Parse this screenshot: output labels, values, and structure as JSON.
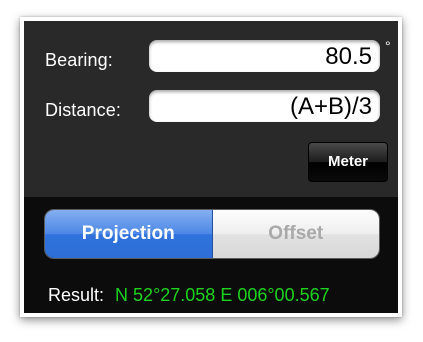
{
  "fields": {
    "bearing": {
      "label": "Bearing:",
      "value": "80.5",
      "unit_symbol": "°"
    },
    "distance": {
      "label": "Distance:",
      "value": "(A+B)/3"
    }
  },
  "unit_button": {
    "label": "Meter"
  },
  "mode_selector": {
    "segments": [
      {
        "label": "Projection",
        "selected": true
      },
      {
        "label": "Offset",
        "selected": false
      }
    ]
  },
  "result": {
    "label": "Result:",
    "value": "N 52°27.058 E 006°00.567"
  },
  "colors": {
    "result_value": "#1ed31e",
    "selected_segment": "#3b7de0",
    "panel_dark": "#292929"
  }
}
